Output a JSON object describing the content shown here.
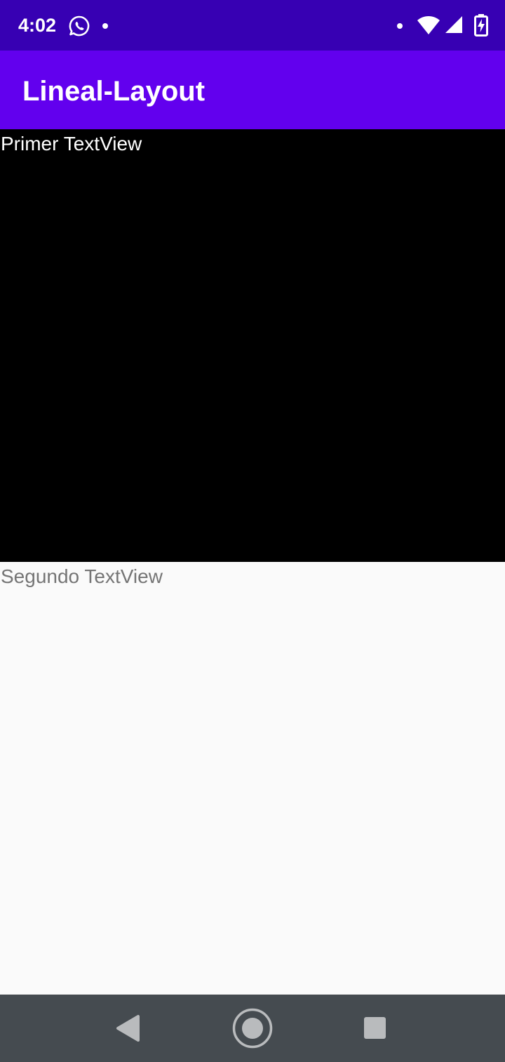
{
  "status_bar": {
    "time": "4:02",
    "icons": [
      "whatsapp-icon",
      "notification-dot-icon",
      "notification-dot-icon",
      "wifi-icon",
      "cell-signal-icon",
      "battery-charging-icon"
    ]
  },
  "app_bar": {
    "title": "Lineal-Layout"
  },
  "content": {
    "first_textview": {
      "text": "Primer TextView",
      "background": "#000000",
      "text_color": "#ffffff"
    },
    "second_textview": {
      "text": "Segundo TextView",
      "background": "#fafafa",
      "text_color": "#757575"
    }
  },
  "nav_bar": {
    "buttons": [
      "back-icon",
      "home-icon",
      "recents-icon"
    ]
  },
  "colors": {
    "status_bar": "#3700b3",
    "app_bar": "#6200ee",
    "nav_bar": "#454b50"
  }
}
